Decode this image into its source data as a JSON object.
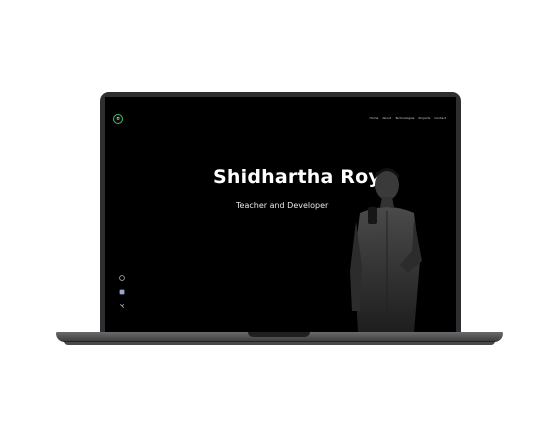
{
  "hero": {
    "name": "Shidhartha Roy",
    "role": "Teacher and Developer"
  },
  "nav": {
    "items": [
      {
        "label": "Home"
      },
      {
        "label": "About"
      },
      {
        "label": "Technologies"
      },
      {
        "label": "Projects"
      },
      {
        "label": "Contact"
      }
    ]
  },
  "logo": {
    "text": "ʊ"
  },
  "social": {
    "icons": [
      "github-icon",
      "linkedin-icon",
      "twitter-icon"
    ]
  },
  "colors": {
    "screen_bg": "#000000",
    "accent": "#3fbf6b",
    "text": "#ffffff"
  }
}
